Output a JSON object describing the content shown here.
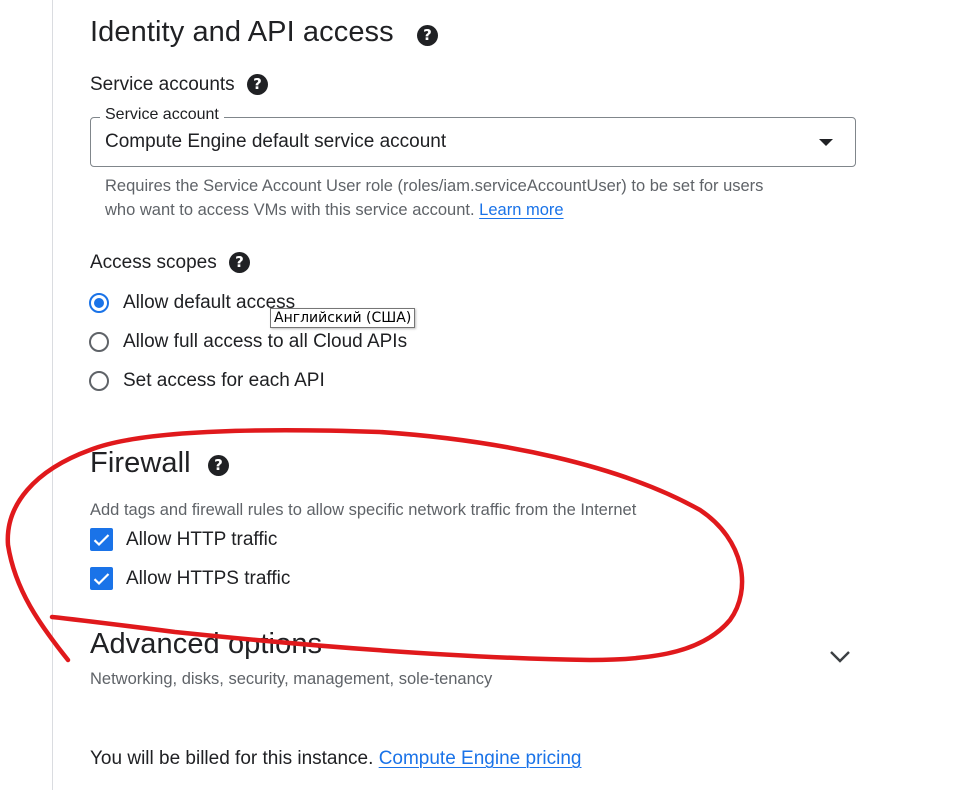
{
  "identity": {
    "title": "Identity and API access",
    "service_accounts_label": "Service accounts",
    "select_legend": "Service account",
    "select_value": "Compute Engine default service account",
    "help_line1": "Requires the Service Account User role (roles/iam.serviceAccountUser) to be set for users",
    "help_line2": "who want to access VMs with this service account.",
    "learn_more": "Learn more"
  },
  "access_scopes": {
    "label": "Access scopes",
    "options": [
      {
        "label": "Allow default access",
        "checked": true
      },
      {
        "label": "Allow full access to all Cloud APIs",
        "checked": false
      },
      {
        "label": "Set access for each API",
        "checked": false
      }
    ]
  },
  "tooltip": "Английский (США)",
  "firewall": {
    "title": "Firewall",
    "description": "Add tags and firewall rules to allow specific network traffic from the Internet",
    "checks": [
      {
        "label": "Allow HTTP traffic",
        "checked": true
      },
      {
        "label": "Allow HTTPS traffic",
        "checked": true
      }
    ]
  },
  "advanced": {
    "title": "Advanced options",
    "subtitle": "Networking, disks, security, management, sole-tenancy"
  },
  "billing": {
    "text": "You will be billed for this instance.",
    "link": "Compute Engine pricing"
  },
  "colors": {
    "accent": "#1a73e8",
    "annotation": "#e0191c",
    "text": "#202124",
    "muted": "#5f6368"
  },
  "icons": [
    "help-icon",
    "caret-down-icon",
    "check-icon",
    "chevron-down-icon"
  ]
}
